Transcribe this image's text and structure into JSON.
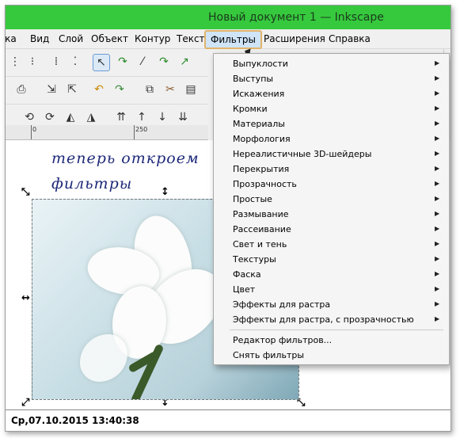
{
  "window": {
    "title": "Новый документ 1 — Inkscape"
  },
  "menubar": {
    "items": [
      {
        "label": "Правка"
      },
      {
        "label": "Вид"
      },
      {
        "label": "Слой"
      },
      {
        "label": "Объект"
      },
      {
        "label": "Контур"
      },
      {
        "label": "Текст"
      },
      {
        "label": "Фильтры",
        "active": true
      },
      {
        "label": "Расширения"
      },
      {
        "label": "Справка"
      }
    ]
  },
  "ruler": {
    "labels": [
      "0",
      "250"
    ]
  },
  "canvas": {
    "text_line1": "теперь откроем",
    "text_line2": "фильтры"
  },
  "filters_menu": {
    "items": [
      {
        "label": "Выпуклости",
        "submenu": true
      },
      {
        "label": "Выступы",
        "submenu": true
      },
      {
        "label": "Искажения",
        "submenu": true
      },
      {
        "label": "Кромки",
        "submenu": true
      },
      {
        "label": "Материалы",
        "submenu": true
      },
      {
        "label": "Морфология",
        "submenu": true
      },
      {
        "label": "Нереалистичные 3D-шейдеры",
        "submenu": true
      },
      {
        "label": "Перекрытия",
        "submenu": true
      },
      {
        "label": "Прозрачность",
        "submenu": true
      },
      {
        "label": "Простые",
        "submenu": true
      },
      {
        "label": "Размывание",
        "submenu": true
      },
      {
        "label": "Рассеивание",
        "submenu": true
      },
      {
        "label": "Свет и тень",
        "submenu": true
      },
      {
        "label": "Текстуры",
        "submenu": true
      },
      {
        "label": "Фаска",
        "submenu": true
      },
      {
        "label": "Цвет",
        "submenu": true
      },
      {
        "label": "Эффекты для растра",
        "submenu": true
      },
      {
        "label": "Эффекты для растра, с прозрачностью",
        "submenu": true
      }
    ],
    "extra_items": [
      {
        "label": "Редактор фильтров..."
      },
      {
        "label": "Снять фильтры"
      }
    ]
  },
  "statusbar": {
    "text": "Ср,07.10.2015 13:40:38"
  },
  "colors": {
    "titlebar": "#36c93e",
    "menu_highlight": "#cfe4f7",
    "menu_outline": "#e0b46a",
    "handwriting": "#1f2a7a"
  }
}
